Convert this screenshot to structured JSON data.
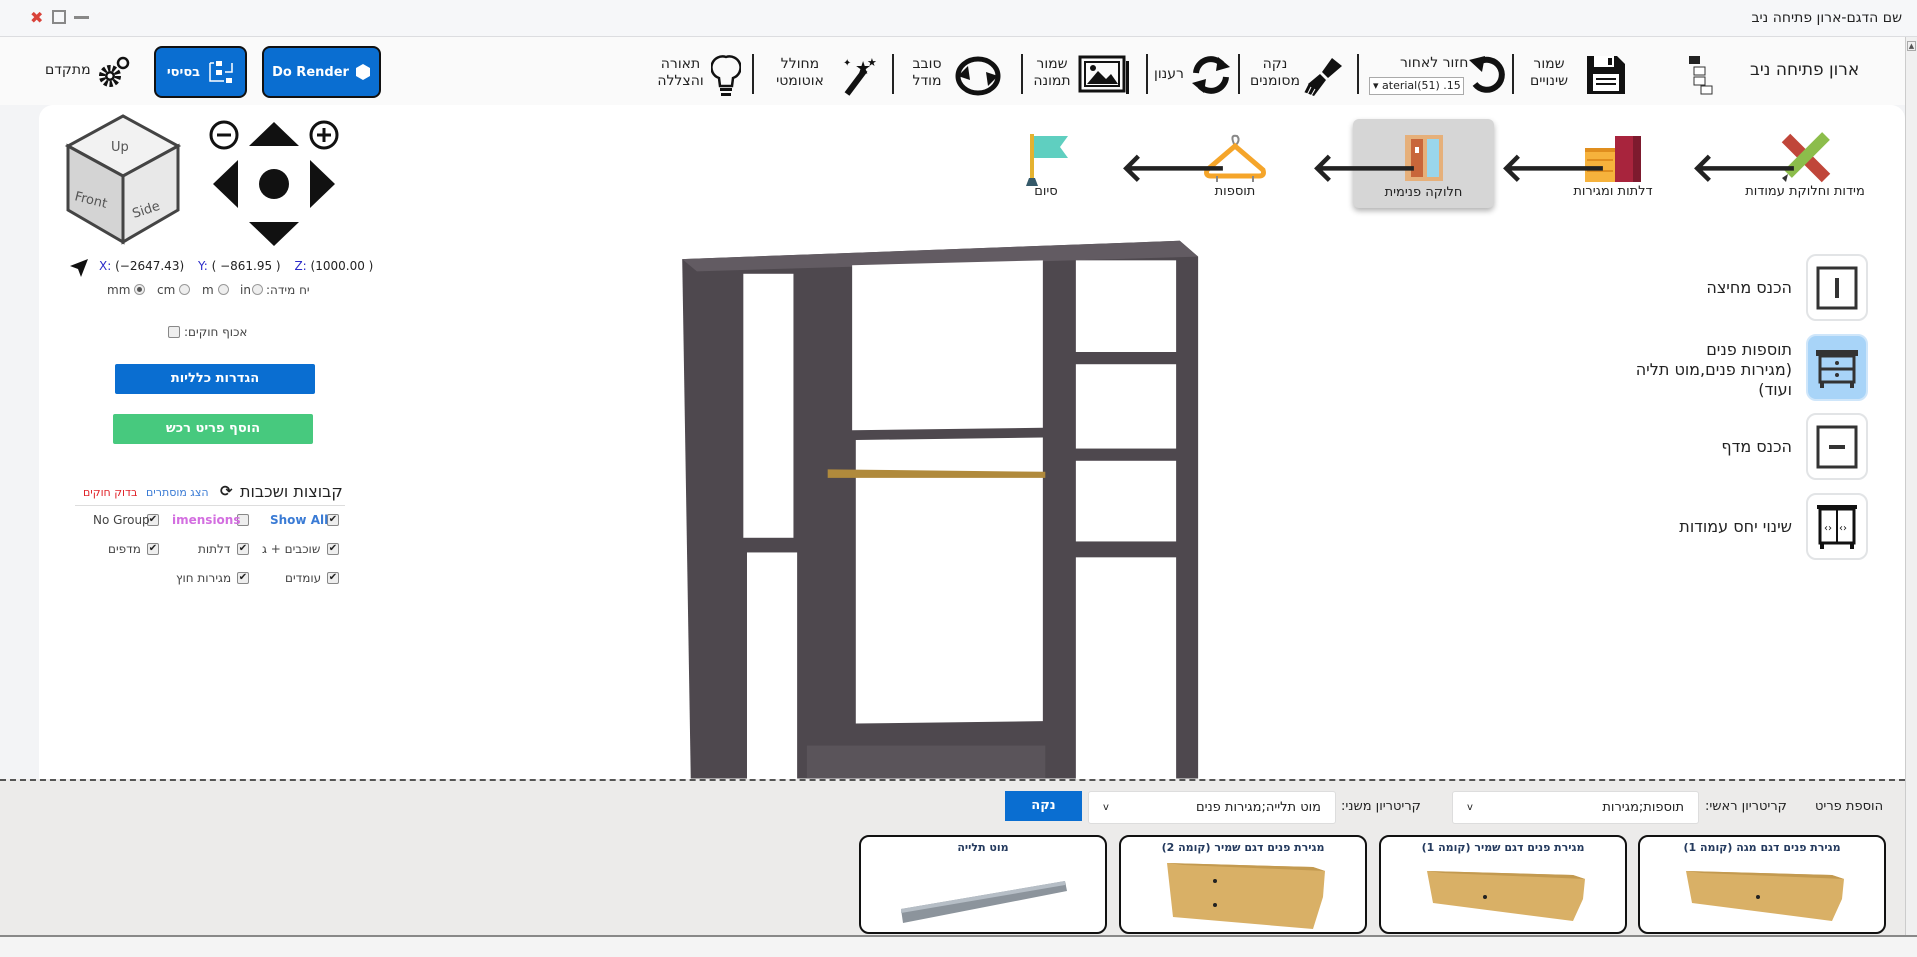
{
  "window": {
    "title": "שם הדגם-ארון פתיחה ניב",
    "controls": [
      "close-icon",
      "maximize-icon",
      "minimize-icon"
    ]
  },
  "toolbar": {
    "app_name": "ארון פתיחה ניב",
    "save": "שמור\nשינויים",
    "undo": "חזור לאחור",
    "undo_select": "aterial(51) .15",
    "clear_marked": "נקה\nמסומנים",
    "refresh": "רענון",
    "save_image": "שמור\nתמונה",
    "rotate_model": "סובב\nמודל",
    "auto_generator": "מחולל\nאוטומטי",
    "lighting": "תאורה\nוהצללה",
    "do_render": "Do Render",
    "basic": "בסיסי",
    "advanced": "מתקדם"
  },
  "steps": [
    {
      "label": "מידות וחלוקת עמודות",
      "selected": false
    },
    {
      "label": "דלתות ומגירות",
      "selected": false
    },
    {
      "label": "חלוקה פנימית",
      "selected": true
    },
    {
      "label": "תוספות",
      "selected": false
    },
    {
      "label": "סיום",
      "selected": false
    }
  ],
  "tools": [
    {
      "label": "הכנס מחיצה",
      "active": false
    },
    {
      "label": "תוספות פנים\n(מגירות פנים,מוט תליה\nועוד)",
      "active": true
    },
    {
      "label": "הכנס מדף",
      "active": false
    },
    {
      "label": "שינוי יחס עמודות",
      "active": false
    }
  ],
  "view_cube": {
    "up": "Up",
    "front": "Front",
    "side": "Side"
  },
  "coords": {
    "x_label": "X:",
    "x": "(−2647.43)",
    "y_label": "Y:",
    "y": "( −861.95 )",
    "z_label": "Z:",
    "z": "(1000.00 )"
  },
  "units": {
    "label": "יח מידה:",
    "options": [
      "mm",
      "cm",
      "m",
      "in"
    ],
    "selected": "mm"
  },
  "enforce_rules": {
    "label": "אכוף חוקים:",
    "checked": false
  },
  "general_settings_button": "הגדרות כלליות",
  "add_furniture_button": "הוסף פריט רכש",
  "groups": {
    "title": "קבוצות ושכבות",
    "show_hidden": "הצג מוסתרים",
    "check_rules": "בדוק חוקים",
    "items": [
      {
        "label": "Show All",
        "checked": true
      },
      {
        "label": "imensions",
        "checked": false
      },
      {
        "label": "No Group",
        "checked": true
      },
      {
        "label": "שוכבים + ג",
        "checked": true
      },
      {
        "label": "דלתות",
        "checked": true
      },
      {
        "label": "מדפים",
        "checked": true
      },
      {
        "label": "עומדים",
        "checked": true
      },
      {
        "label": "מגירות חוץ",
        "checked": true
      }
    ]
  },
  "add_item": {
    "title": "הוספת פריט",
    "primary_label": "קריטריון ראשי:",
    "primary_value": "תוספות;מגירות",
    "secondary_label": "קריטריון משני:",
    "secondary_value": "מוט תלייה;מגירות פנים",
    "clear": "נקה",
    "cards": [
      {
        "title": "מגירת פנים דגם מגה (קומה 1)"
      },
      {
        "title": "מגירת פנים דגם שמיר (קומה 1)"
      },
      {
        "title": "מגירת פנים דגם שמיר (קומה 2)"
      },
      {
        "title": "מוט תלייה"
      }
    ]
  },
  "colors": {
    "accent": "#0a6ed1",
    "green": "#47c97e",
    "active_tool": "#a8d4f8",
    "wardrobe": "#4e484e",
    "rod": "#b08a3c"
  }
}
